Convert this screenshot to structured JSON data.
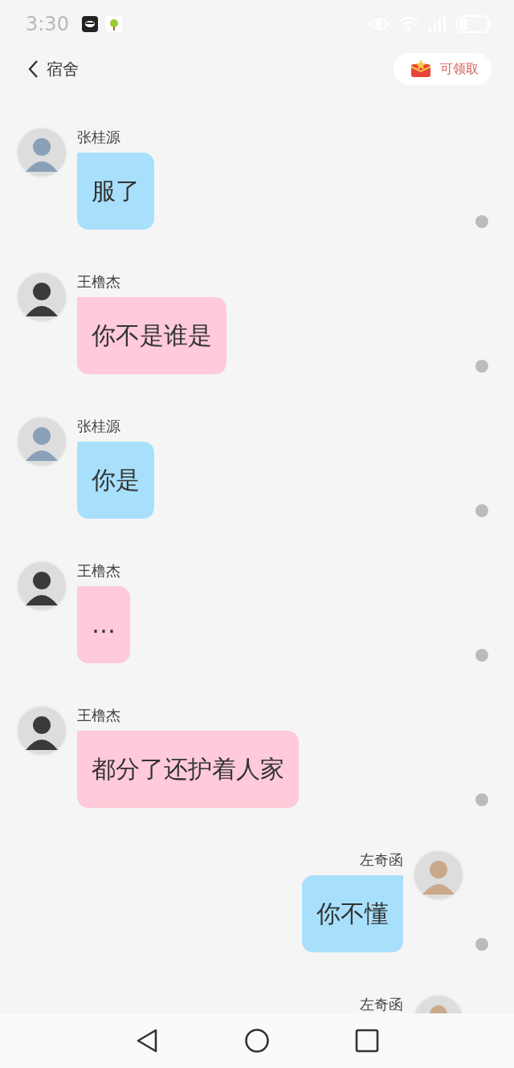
{
  "status_bar": {
    "time": "3:30"
  },
  "header": {
    "title": "宿舍",
    "reward_button": "可领取"
  },
  "messages": [
    {
      "kind": "received",
      "sender": "张桂源",
      "text": "服了",
      "color": "#a8e0fc"
    },
    {
      "kind": "received",
      "sender": "王橹杰",
      "text": "你不是谁是",
      "color": "#ffcad9"
    },
    {
      "kind": "received",
      "sender": "张桂源",
      "text": "你是",
      "color": "#a8e0fc"
    },
    {
      "kind": "received",
      "sender": "王橹杰",
      "text": "…",
      "color": "#ffcad9"
    },
    {
      "kind": "received",
      "sender": "王橹杰",
      "text": "都分了还护着人家",
      "color": "#ffcad9"
    },
    {
      "kind": "sent",
      "sender": "左奇函",
      "text": "你不懂",
      "color": "#a8e0fc"
    },
    {
      "kind": "sent",
      "sender": "左奇函"
    }
  ]
}
